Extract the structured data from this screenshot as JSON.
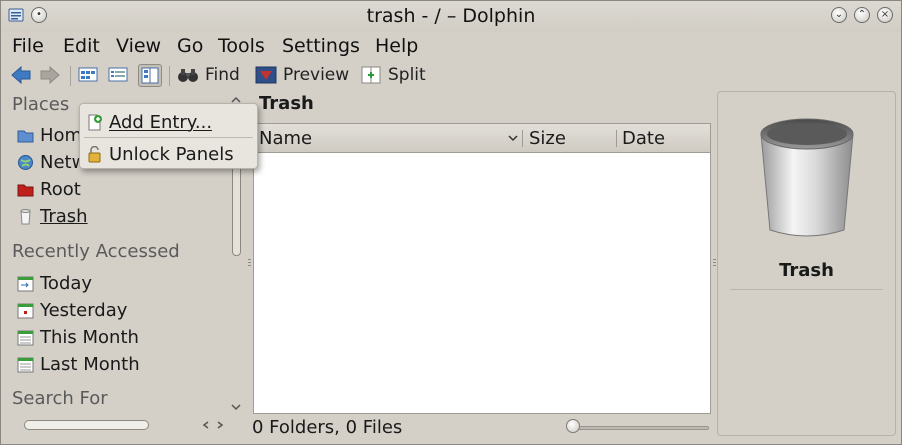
{
  "window": {
    "title": "trash - / – Dolphin"
  },
  "menubar": {
    "items": [
      "File",
      "Edit",
      "View",
      "Go",
      "Tools",
      "Settings",
      "Help"
    ]
  },
  "toolbar": {
    "find": "Find",
    "preview": "Preview",
    "split": "Split"
  },
  "places": {
    "title": "Places",
    "items": [
      "Home",
      "Network",
      "Root",
      "Trash"
    ],
    "recent_title": "Recently Accessed",
    "recent": [
      "Today",
      "Yesterday",
      "This Month",
      "Last Month"
    ],
    "search_title": "Search For"
  },
  "context_menu": {
    "items": [
      "Add Entry...",
      "Unlock Panels"
    ]
  },
  "content": {
    "location": "Trash",
    "columns": [
      "Name",
      "Size",
      "Date"
    ],
    "status": "0 Folders, 0 Files"
  },
  "info_panel": {
    "name": "Trash"
  },
  "colors": {
    "window_bg": "#d4d0c8",
    "list_bg": "#ffffff",
    "accent_blue": "#3f7bc2"
  }
}
